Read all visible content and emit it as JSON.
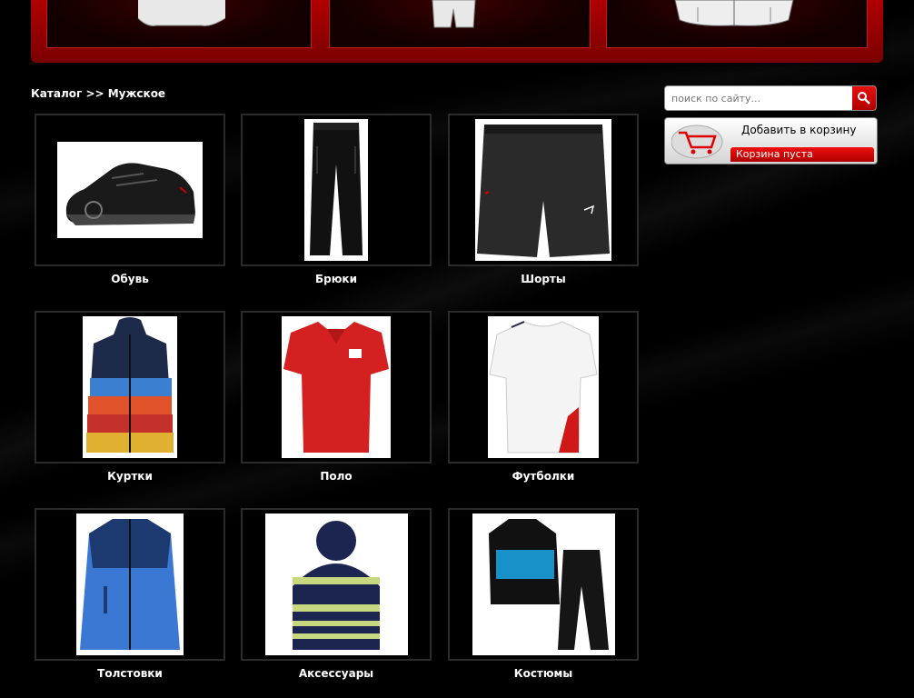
{
  "breadcrumb": "Каталог >> Мужское",
  "search": {
    "placeholder": "поиск по сайту..."
  },
  "cart": {
    "title": "Добавить в корзину",
    "status": "Корзина пуста"
  },
  "categories": [
    {
      "label": "Обувь",
      "icon": "shoe-image"
    },
    {
      "label": "Брюки",
      "icon": "pants-image"
    },
    {
      "label": "Шорты",
      "icon": "shorts-image"
    },
    {
      "label": "Куртки",
      "icon": "jacket-image"
    },
    {
      "label": "Поло",
      "icon": "polo-image"
    },
    {
      "label": "Футболки",
      "icon": "tshirt-image"
    },
    {
      "label": "Толстовки",
      "icon": "hoodie-image"
    },
    {
      "label": "Аксессуары",
      "icon": "beanie-image"
    },
    {
      "label": "Костюмы",
      "icon": "tracksuit-image"
    }
  ],
  "colors": {
    "accent": "#c00000",
    "background": "#000000"
  }
}
